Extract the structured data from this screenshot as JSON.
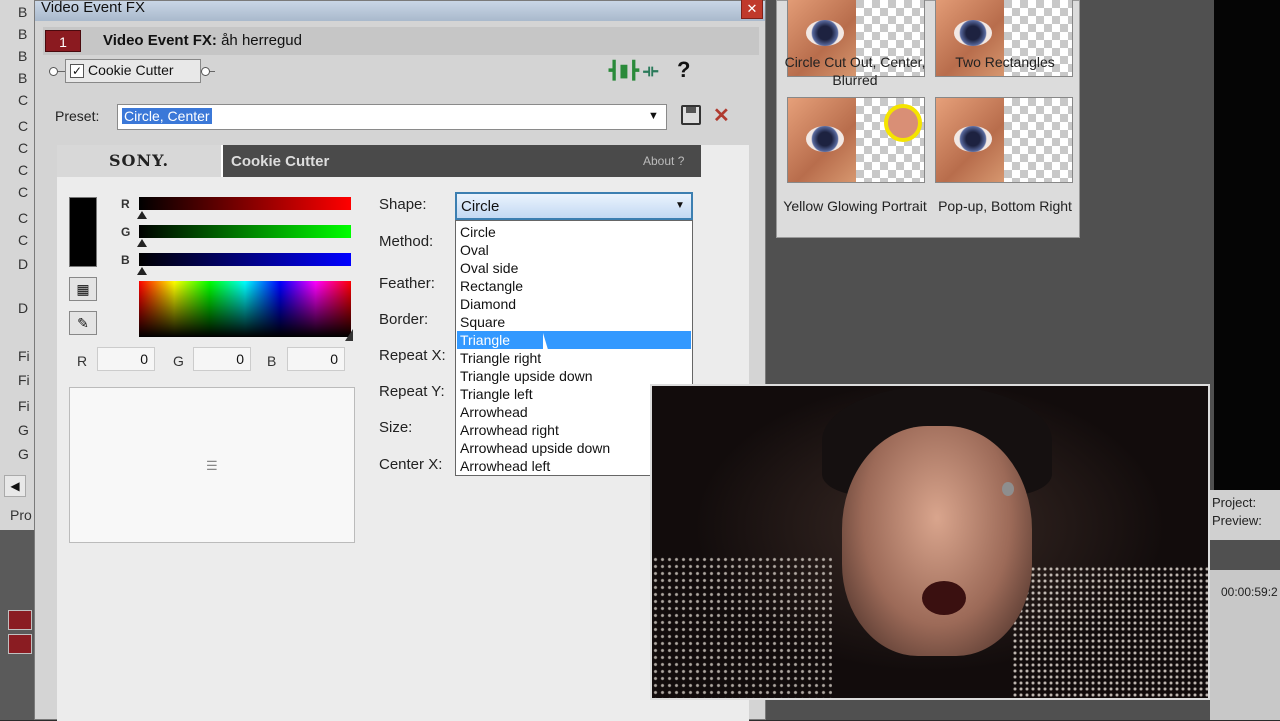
{
  "host": {
    "left_items": [
      "B",
      "B",
      "B",
      "B",
      "C",
      "C",
      "C",
      "C",
      "C",
      "C",
      "C",
      "D",
      "D",
      "Fi",
      "Fi",
      "Fi",
      "G",
      "G"
    ],
    "project_label": "Pro",
    "project_info": [
      "Project:",
      "Preview:"
    ],
    "timecode": "00:00:59:2"
  },
  "presets_panel": {
    "items": [
      {
        "label": "Circle Cut Out, Center, Blurred"
      },
      {
        "label": "Two Rectangles"
      },
      {
        "label": "Yellow Glowing Portrait"
      },
      {
        "label": "Pop-up, Bottom Right"
      }
    ]
  },
  "dialog": {
    "title": "Video Event FX",
    "close_label": "✕",
    "fx_badge": "1",
    "fx_title_prefix": "Video Event FX:",
    "fx_event_name": "åh herregud",
    "plugin_chain_label": "Cookie Cutter",
    "plugin_enabled": true,
    "help_label": "?",
    "preset_label": "Preset:",
    "preset_value": "Circle, Center"
  },
  "plugin": {
    "brand": "SONY.",
    "name": "Cookie Cutter",
    "about_label": "About  ?",
    "color": {
      "r_label": "R",
      "g_label": "G",
      "b_label": "B",
      "r_value": "0",
      "g_value": "0",
      "b_value": "0",
      "swatch": "#000000"
    },
    "params": {
      "shape_label": "Shape:",
      "method_label": "Method:",
      "feather_label": "Feather:",
      "border_label": "Border:",
      "repeat_x_label": "Repeat X:",
      "repeat_y_label": "Repeat Y:",
      "size_label": "Size:",
      "center_x_label": "Center X:"
    },
    "shape_value": "Circle",
    "shape_options": [
      "Circle",
      "Oval",
      "Oval side",
      "Rectangle",
      "Diamond",
      "Square",
      "Triangle",
      "Triangle right",
      "Triangle upside down",
      "Triangle left",
      "Arrowhead",
      "Arrowhead right",
      "Arrowhead upside down",
      "Arrowhead left"
    ],
    "shape_highlighted": "Triangle"
  },
  "colors": {
    "accent": "#3399ff",
    "fx_badge": "#8b1a20",
    "titlebar": "#a9b9cc"
  }
}
